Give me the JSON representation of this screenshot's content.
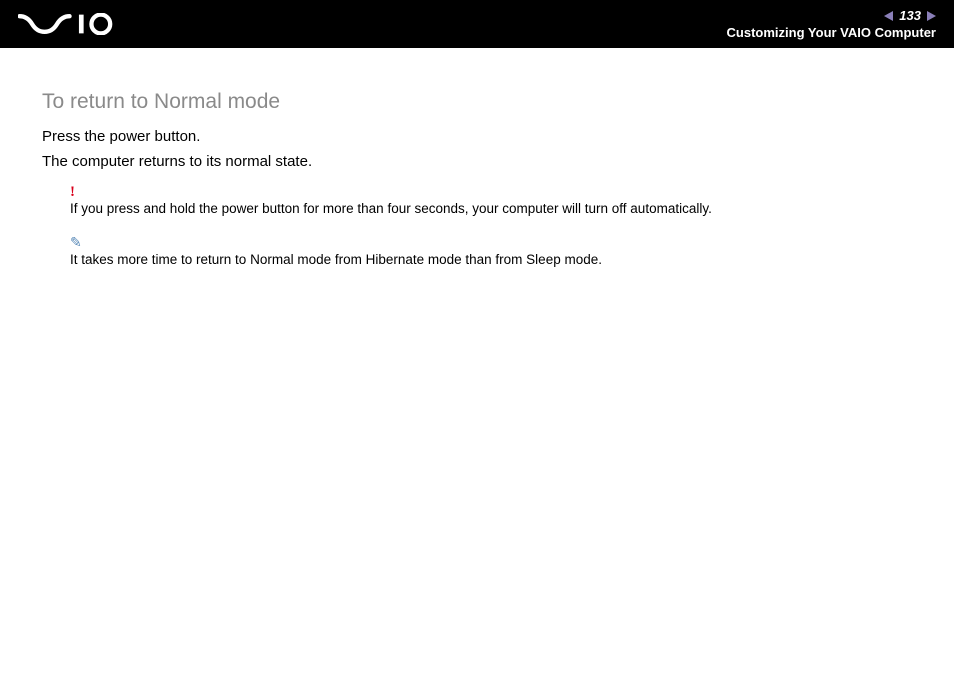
{
  "header": {
    "page_number": "133",
    "section_title": "Customizing Your VAIO Computer"
  },
  "content": {
    "heading": "To return to Normal mode",
    "p1": "Press the power button.",
    "p2": "The computer returns to its normal state.",
    "warning_mark": "!",
    "warning_text": "If you press and hold the power button for more than four seconds, your computer will turn off automatically.",
    "info_mark": "✎",
    "info_text": "It takes more time to return to Normal mode from Hibernate mode than from Sleep mode."
  }
}
